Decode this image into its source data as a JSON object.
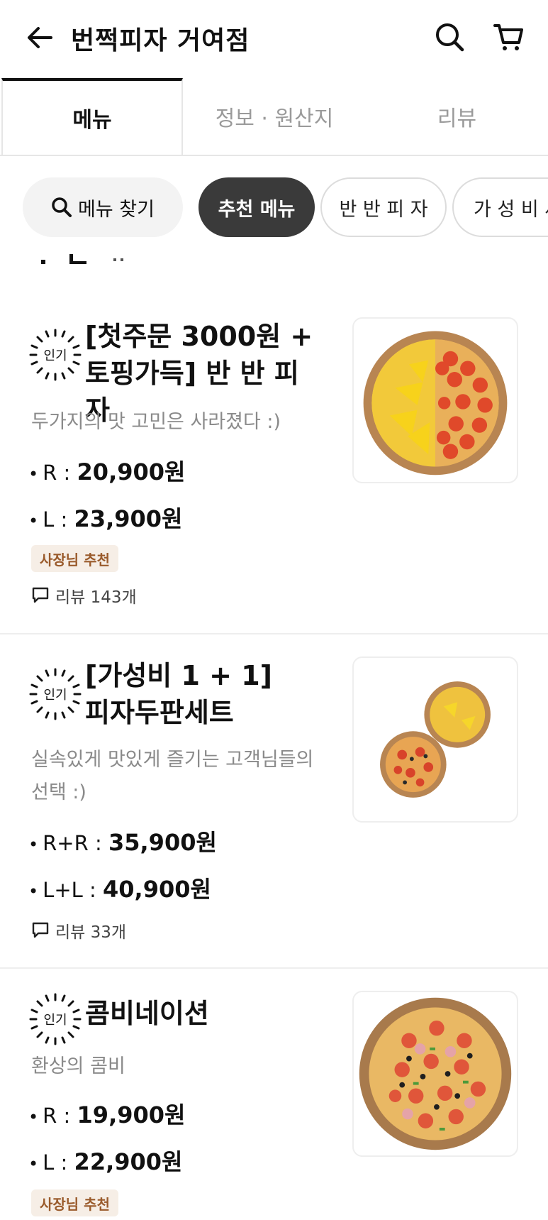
{
  "header": {
    "title": "번쩍피자 거여점",
    "back_icon": "arrow-left-icon",
    "search_icon": "search-icon",
    "cart_icon": "cart-icon"
  },
  "tabs": [
    {
      "label": "메뉴",
      "active": true
    },
    {
      "label": "정보 · 원산지",
      "active": false
    },
    {
      "label": "리뷰",
      "active": false
    }
  ],
  "chips": {
    "search": "메뉴 찾기",
    "items": [
      "추천 메뉴",
      "반 반 피 자",
      "가 성 비 세"
    ]
  },
  "colors": {
    "active_chip": "#3a3a3a",
    "owner_tag_bg": "#f6eee6",
    "owner_tag_text": "#9a5b2c"
  },
  "badge_label": "인기",
  "menu_items": [
    {
      "name_line1": "[첫주문 3000원 +",
      "name_line2": "토핑가득] 반 반 피 자",
      "description": "두가지의  맛 고민은 사라졌다 :)",
      "prices": [
        {
          "size": "R",
          "price": "20,900원"
        },
        {
          "size": "L",
          "price": "23,900원"
        }
      ],
      "tag": "사장님 추천",
      "review": "리뷰 143개"
    },
    {
      "name_line1": "[가성비 1 + 1]",
      "name_line2": "피자두판세트",
      "description": "실속있게 맛있게 즐기는 고객님들의 선택 :)",
      "prices": [
        {
          "size": "R+R",
          "price": "35,900원"
        },
        {
          "size": "L+L",
          "price": "40,900원"
        }
      ],
      "review": "리뷰 33개"
    },
    {
      "name_line1": "콤비네이션",
      "description": "환상의 콤비",
      "prices": [
        {
          "size": "R",
          "price": "19,900원"
        },
        {
          "size": "L",
          "price": "22,900원"
        }
      ],
      "tag": "사장님 추천"
    }
  ]
}
